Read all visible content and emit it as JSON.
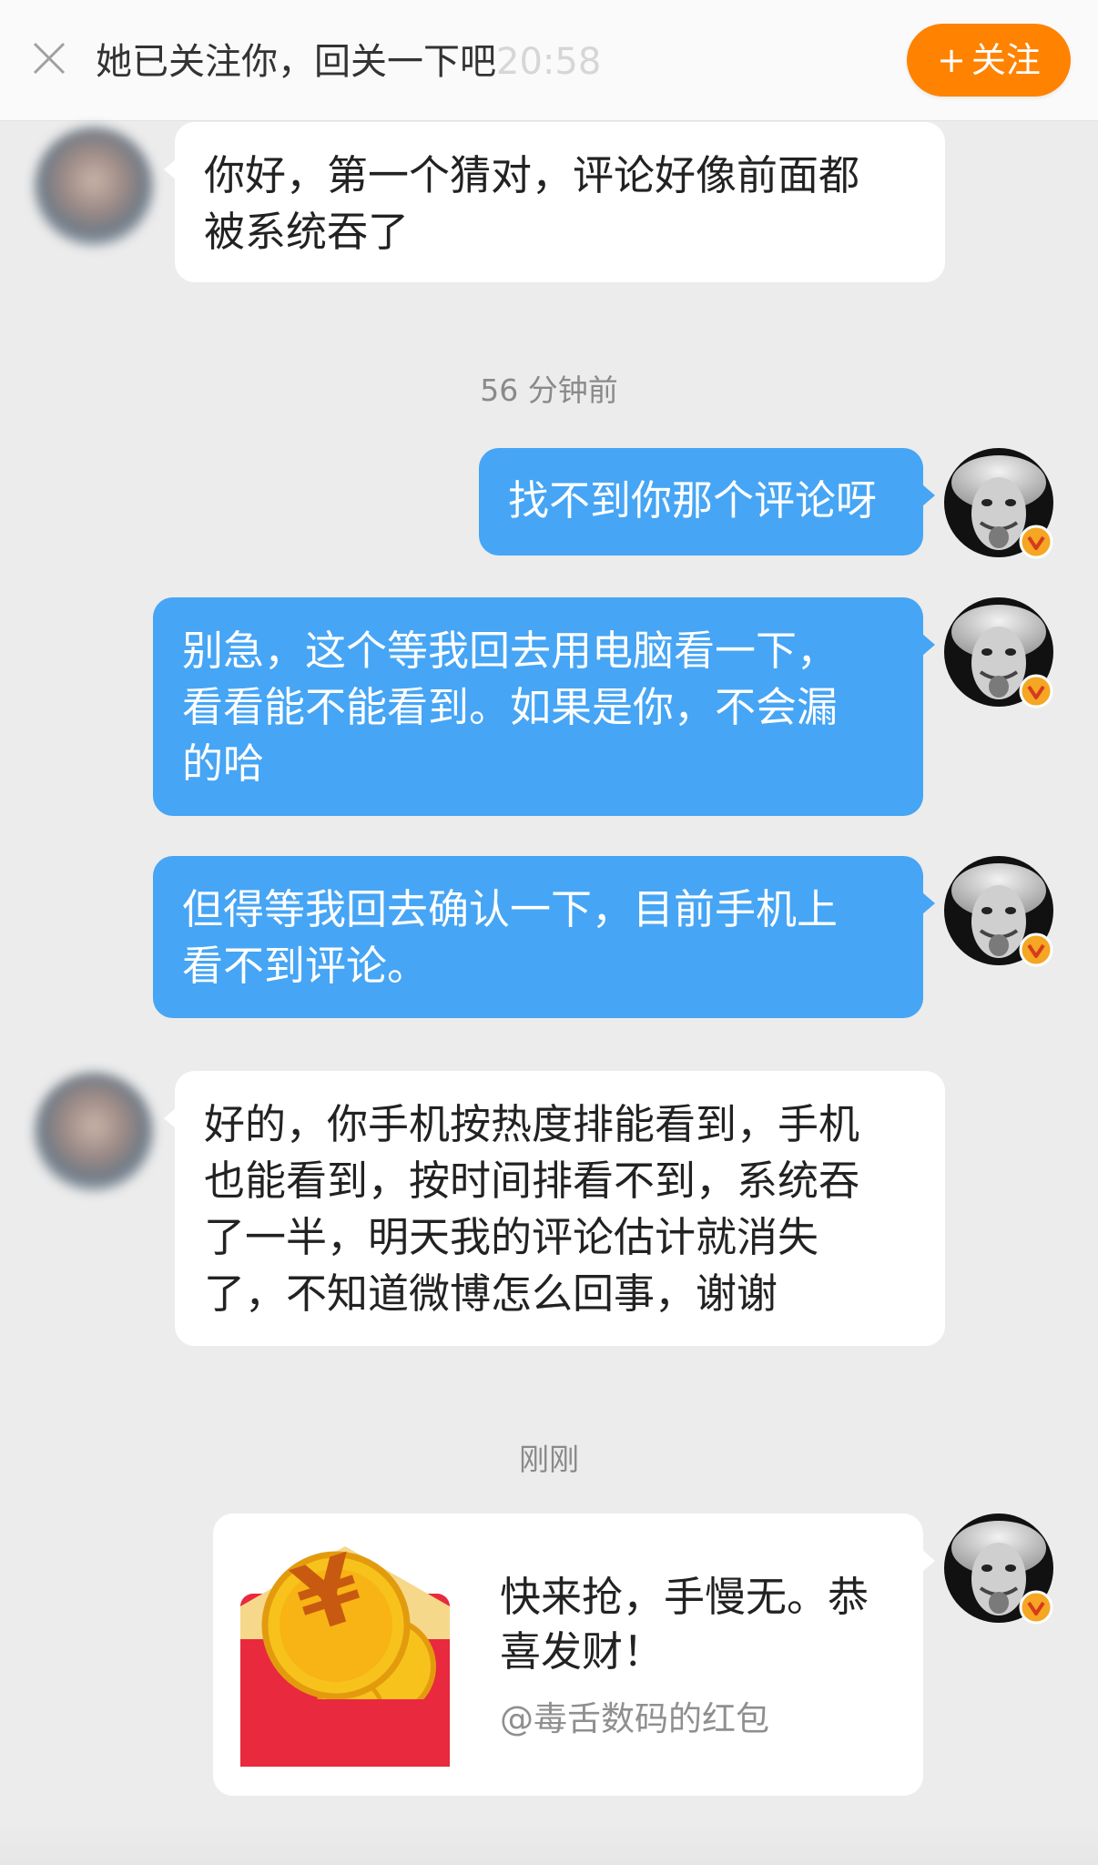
{
  "banner": {
    "text": "她已关注你，回关一下吧",
    "ghost_time": "20:58",
    "follow_label": "关注",
    "follow_plus": "+"
  },
  "messages": [
    {
      "side": "left",
      "text_lines": [
        "你好，第一个猜对，评论好像前面都",
        "被系统吞了"
      ]
    },
    {
      "side": "right",
      "text_lines": [
        "找不到你那个评论呀"
      ]
    },
    {
      "side": "right",
      "text_lines": [
        "别急，这个等我回去用电脑看一下，",
        "看看能不能看到。如果是你，不会漏",
        "的哈"
      ]
    },
    {
      "side": "right",
      "text_lines": [
        "但得等我回去确认一下，目前手机上",
        "看不到评论。"
      ]
    },
    {
      "side": "left",
      "text_lines": [
        "好的，你手机按热度排能看到，手机",
        "也能看到，按时间排看不到，系统吞",
        "了一半，明天我的评论估计就消失",
        "了，不知道微博怎么回事，谢谢"
      ]
    }
  ],
  "timestamps": {
    "t1": "56 分钟前",
    "t2": "刚刚"
  },
  "red_packet": {
    "title_lines": [
      "快来抢，手慢无。恭",
      "喜发财！"
    ],
    "subtitle": "@毒舌数码的红包",
    "currency_symbol": "¥"
  },
  "colors": {
    "accent_orange": "#ff8200",
    "bubble_blue": "#46a5f5",
    "background": "#ececec",
    "packet_red": "#e8293e",
    "coin_gold": "#f8c21c",
    "verified_orange": "#f5a623"
  },
  "icons": {
    "close": "close-icon",
    "verified": "verified-badge-icon",
    "red_packet": "red-packet-icon"
  }
}
